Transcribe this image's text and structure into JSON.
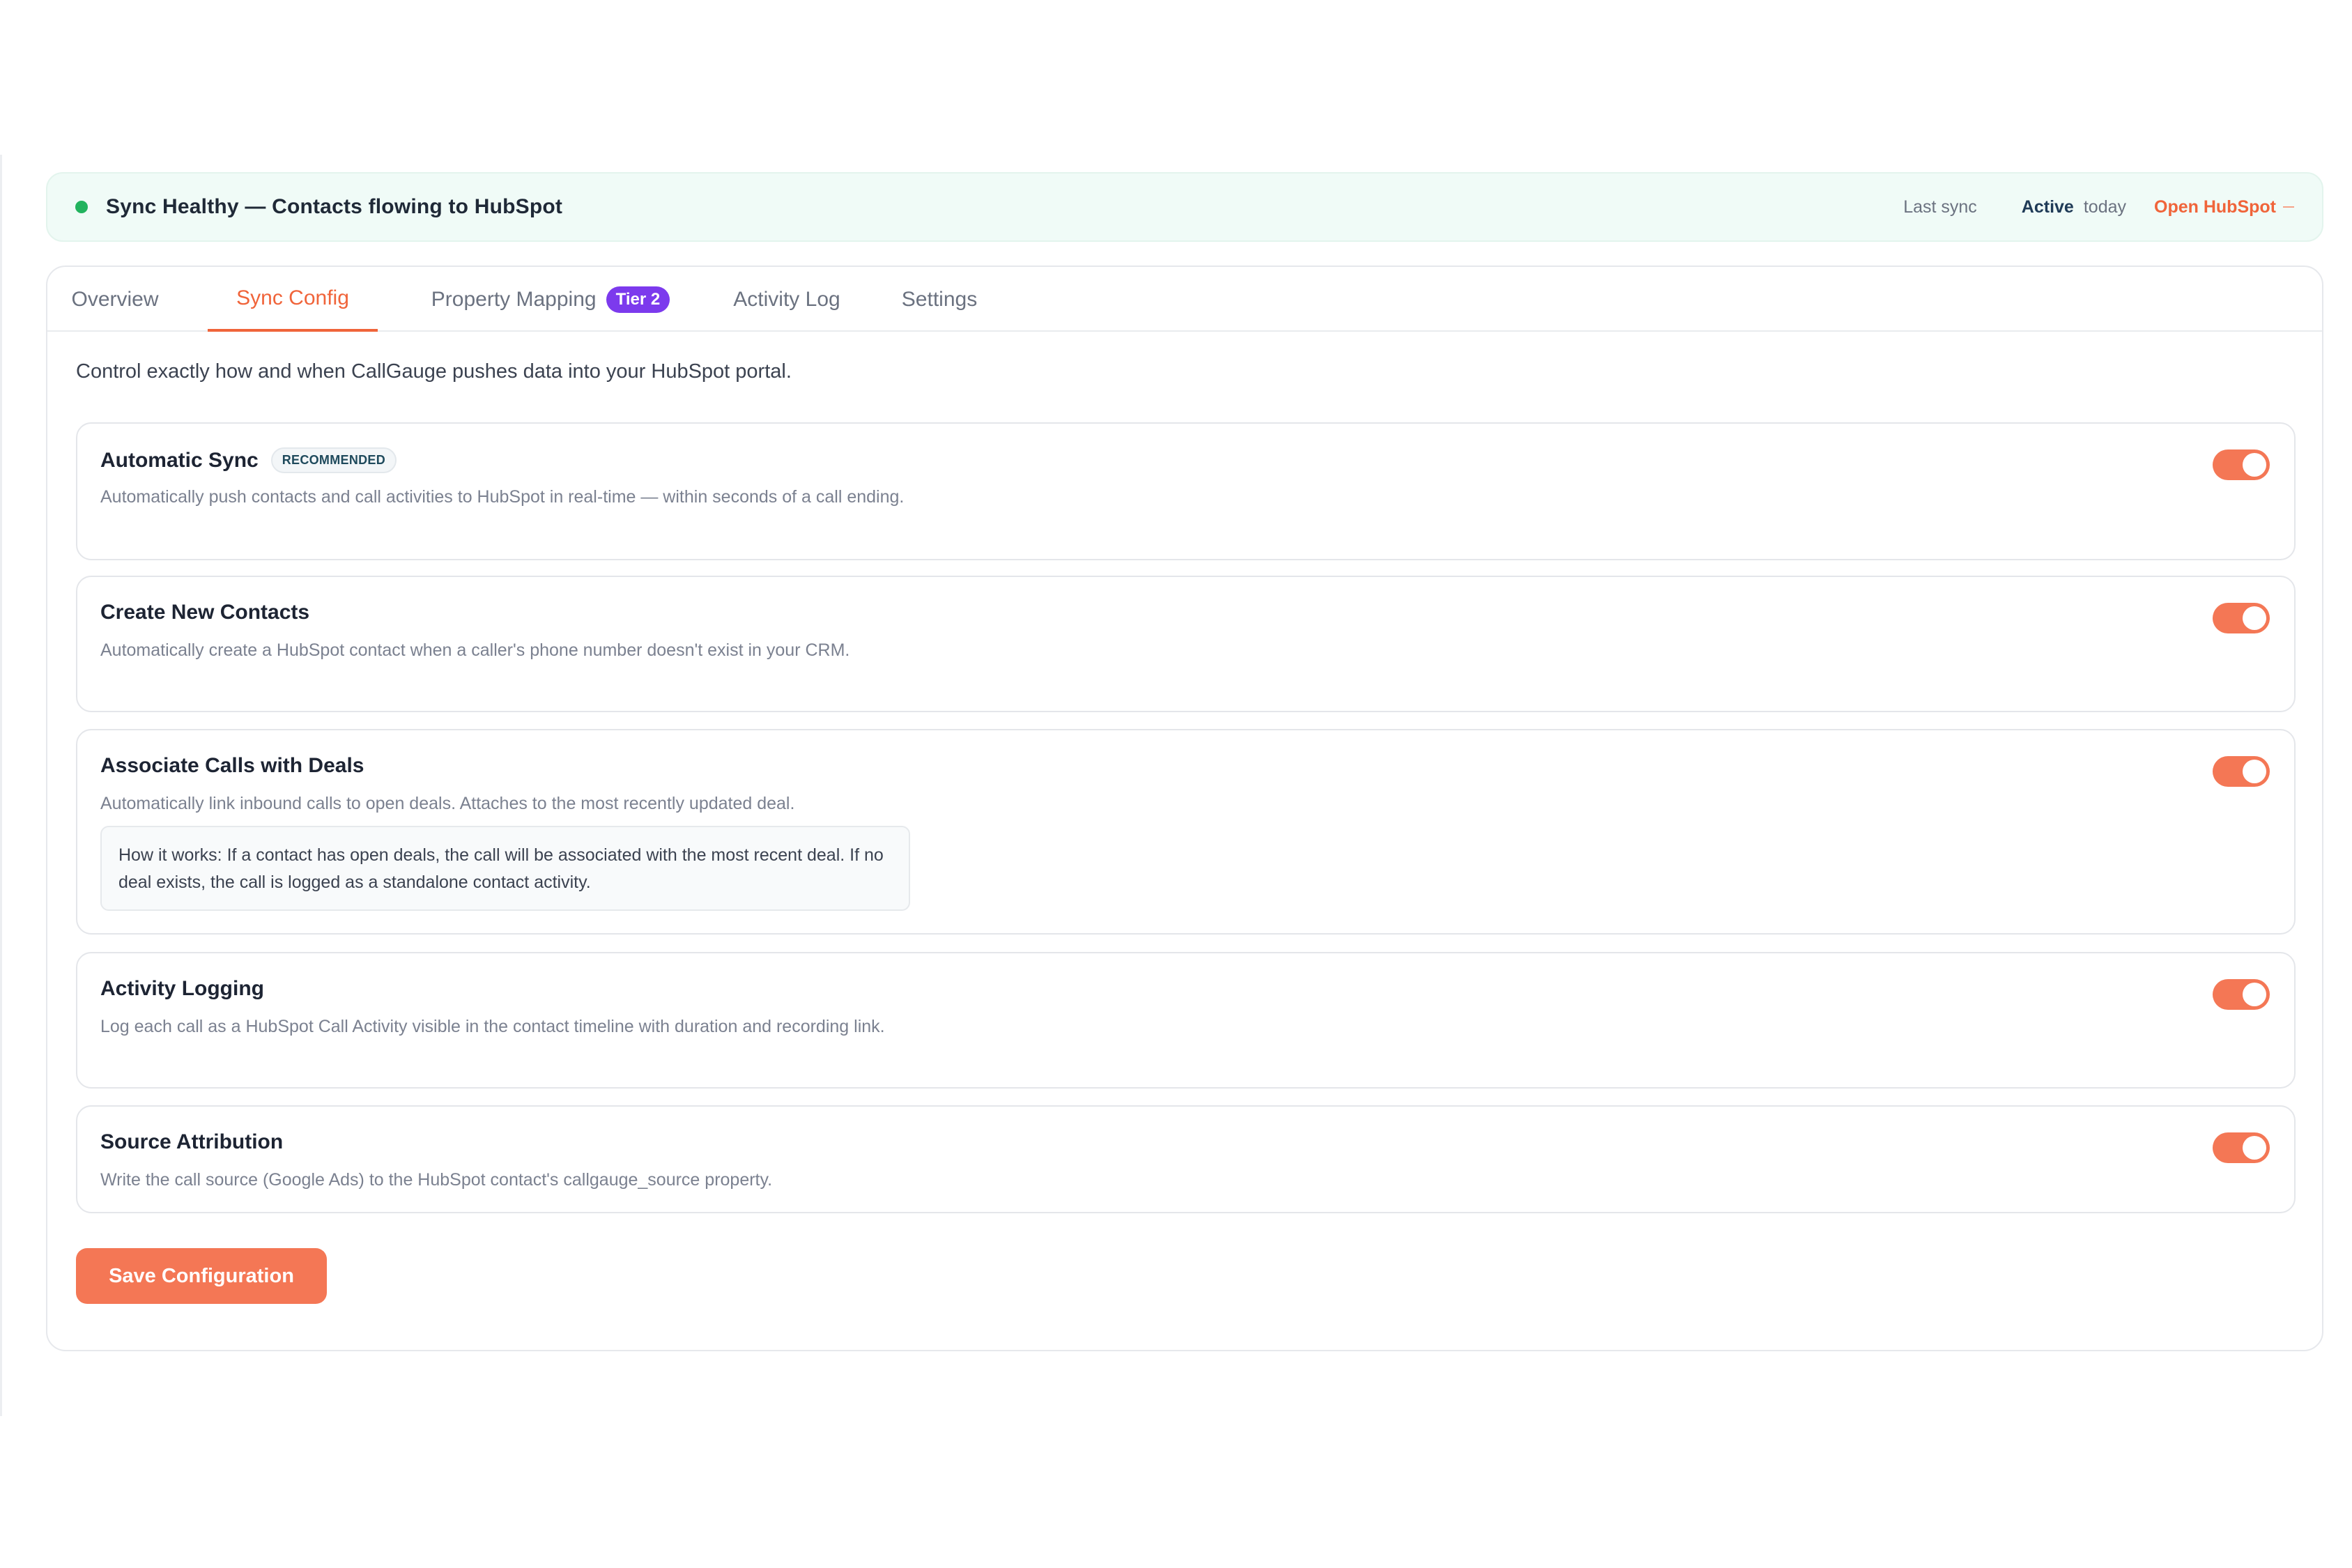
{
  "status": {
    "text": "Sync Healthy — Contacts flowing to HubSpot",
    "last_sync_label": "Last sync",
    "active_label": "Active",
    "today_label": "today",
    "open_link": "Open HubSpot"
  },
  "tabs": [
    {
      "label": "Overview"
    },
    {
      "label": "Sync Config",
      "active": true
    },
    {
      "label": "Property Mapping",
      "badge": "Tier 2"
    },
    {
      "label": "Activity Log"
    },
    {
      "label": "Settings"
    }
  ],
  "intro": "Control exactly how and when CallGauge pushes data into your HubSpot portal.",
  "settings": [
    {
      "title": "Automatic Sync",
      "badge": "RECOMMENDED",
      "description": "Automatically push contacts and call activities to HubSpot in real-time — within seconds of a call ending.",
      "enabled": true
    },
    {
      "title": "Create New Contacts",
      "description": "Automatically create a HubSpot contact when a caller's phone number doesn't exist in your CRM.",
      "enabled": true
    },
    {
      "title": "Associate Calls with Deals",
      "description": "Automatically link inbound calls to open deals. Attaches to the most recently updated deal.",
      "note": "How it works: If a contact has open deals, the call will be associated with the most recent deal. If no deal exists, the call is logged as a standalone contact activity.",
      "enabled": true
    },
    {
      "title": "Activity Logging",
      "description": "Log each call as a HubSpot Call Activity visible in the contact timeline with duration and recording link.",
      "enabled": true
    },
    {
      "title": "Source Attribution",
      "description": "Write the call source (Google Ads) to the HubSpot contact's callgauge_source property.",
      "enabled": true
    }
  ],
  "save_button": "Save Configuration",
  "colors": {
    "accent": "#f0643a",
    "toggle_on": "#f47755",
    "status_ok": "#22b35e",
    "tier_badge": "#7c3aed"
  }
}
